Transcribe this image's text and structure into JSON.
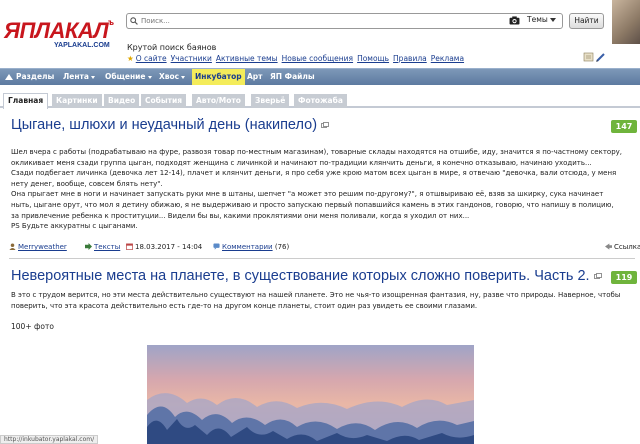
{
  "header": {
    "logo_main": "ЯПЛАКАЛ",
    "logo_sup": "ъ",
    "logo_sub": "YAPLAKAL.COM",
    "search_placeholder": "Поиск...",
    "themes_label": "Темы",
    "find_label": "Найти",
    "tagline": "Крутой поиск баянов",
    "links": [
      "О сайте",
      "Участники",
      "Активные темы",
      "Новые сообщения",
      "Помощь",
      "Правила",
      "Реклама"
    ]
  },
  "nav": {
    "items": [
      {
        "label": "Разделы",
        "dropdown": false
      },
      {
        "label": "Лента",
        "dropdown": true
      },
      {
        "label": "Общение",
        "dropdown": true
      },
      {
        "label": "Хвос",
        "dropdown": true
      },
      {
        "label": "Инкубатор",
        "dropdown": false
      },
      {
        "label": "Арт",
        "dropdown": false
      },
      {
        "label": "ЯП Файлы",
        "dropdown": false
      }
    ]
  },
  "tabs": [
    "Главная",
    "Картинки",
    "Видео",
    "События",
    "Авто/Мото",
    "Зверьё",
    "Фотожаба"
  ],
  "posts": [
    {
      "title": "Цыгане, шлюхи и неудачный день (накипело)",
      "rating": "147",
      "lines": [
        "Шел вчера с работы (подрабатываю на фуре, развозя товар по-местным магазинам), товарные склады находятся на отшибе, иду, значится я по-частному сектору,",
        "окликивает меня сзади группа цыган, подходят женщина с личинкой и начинают по-традиции клянчить деньги, я конечно отказываю, начинаю уходить...",
        "Сзади подбегает личинка (девочка лет 12-14), плачет и клянчит деньги, я про себя уже крою матом всех цыган в мире, я отвечаю \"девочка, вали отсюда, у меня",
        "нету денег, вообще, совсем блять нету\".",
        "Она прыгает мне в ноги и начинает запускать руки мне в штаны, шепчет \"а может это решим по-другому?\", я отшвыриваю её, взяв за шкирку, сука начинает",
        "ныть, цыгане орут, что мол я детину обижаю, я не выдерживаю и просто запускаю первый попавшийся камень в этих гандонов, говорю, что напишу в полицию,",
        "за привлечение ребенка к проституции... Видели бы вы, какими проклятиями они меня поливали, когда я уходил от них...",
        "PS Будьте аккуратны с цыганами."
      ],
      "author": "Merryweather",
      "section": "Тексты",
      "date": "18.03.2017 - 14:04",
      "comments_label": "Комментарии",
      "comments_count": "(76)",
      "share_label": "Ссылка"
    },
    {
      "title": "Невероятные места на планете, в существование которых сложно поверить. Часть 2.",
      "rating": "119",
      "lines": [
        "В это с трудом верится, но эти места действительно существуют на нашей планете. Это не чья-то изощренная фантазия, ну, разве что природы. Наверное, чтобы",
        "поверить, что эта красота действительно есть где-то на другом конце планеты, стоит один раз увидеть ее своими глазами."
      ],
      "photo_count": "100+ фото"
    }
  ],
  "status_url": "http://inkubator.yaplakal.com/",
  "colors": {
    "brand_red": "#c8161d",
    "link_blue": "#1a3d8f",
    "nav_bg": "#6a86ab",
    "badge_green": "#6fb43c",
    "highlight_yellow": "#f4ec5a"
  }
}
